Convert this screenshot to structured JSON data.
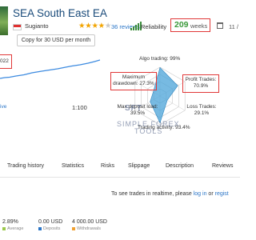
{
  "header": {
    "title": "SEA South East EA",
    "author": "Sugianto",
    "rating": 3.5,
    "reviews_text": "36 reviews",
    "reliability_label": "Reliability",
    "weeks_value": "209",
    "weeks_label": "weeks",
    "extra_value": "11 /",
    "copy_button": "Copy for 30 USD per month"
  },
  "chart": {
    "date_value": "022",
    "live_label": "ive",
    "scale_label": "1:100"
  },
  "radar": {
    "algo_trading": "Algo trading: 99%",
    "max_drawdown": "Maximum\ndrawdown: 27.3%",
    "profit_trades": "Profit Trades:\n70.9%",
    "max_deposit_load": "Max deposit load:\n39.5%",
    "loss_trades": "Loss Trades:\n29.1%",
    "trading_activity": "Trading activity: 93.4%",
    "values": {
      "algo_trading": 99,
      "profit_trades": 70.9,
      "loss_trades": 29.1,
      "trading_activity": 93.4,
      "max_deposit_load": 39.5,
      "max_drawdown": 27.3
    }
  },
  "watermark": {
    "line1": "SFT",
    "line2": "SIMPLE FOREX",
    "line3": "TOOLS"
  },
  "tabs": [
    "Trading history",
    "Statistics",
    "Risks",
    "Slippage",
    "Description",
    "Reviews"
  ],
  "realtime": {
    "prefix": "To see trades in realtime, please",
    "login": "log in",
    "or": "or",
    "register": "regist"
  },
  "stats": [
    {
      "value": "2.89%",
      "label": "Average",
      "color": "#9bc84b"
    },
    {
      "value": "0.00 USD",
      "label": "Deposits",
      "color": "#2a75c7"
    },
    {
      "value": "4 000.00 USD",
      "label": "Withdrawals",
      "color": "#f0a030"
    }
  ],
  "colors": {
    "accent": "#2a75c7",
    "highlight": "#e03838",
    "weeks_green": "#3a9a3a",
    "radar_fill": "#4aa3d8"
  }
}
